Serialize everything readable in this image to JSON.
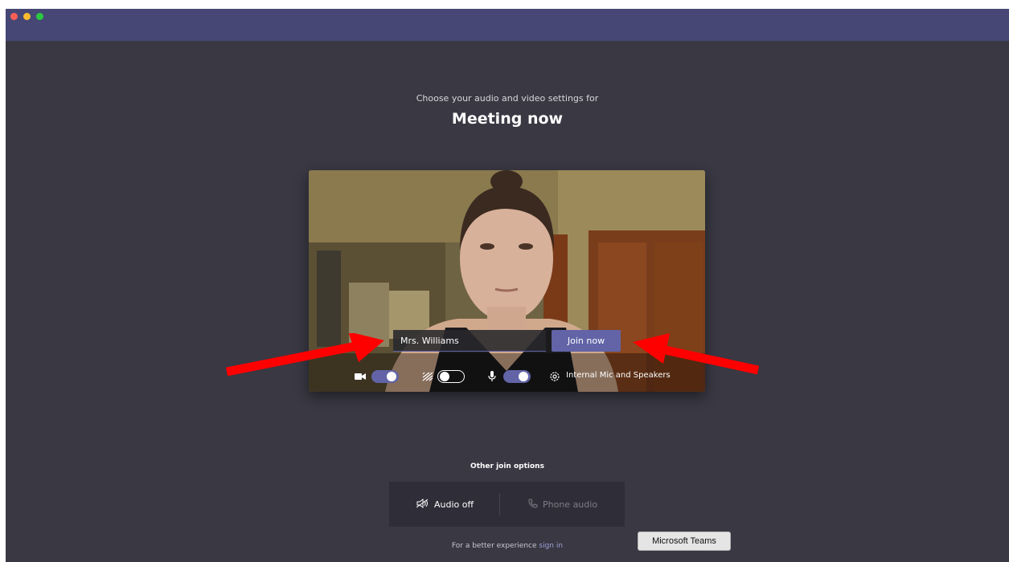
{
  "window": {
    "traffic_lights": [
      "close",
      "minimize",
      "zoom"
    ]
  },
  "prejoin": {
    "subtitle": "Choose your audio and video settings for",
    "meeting_title": "Meeting now"
  },
  "preview": {
    "name_value": "Mrs. Williams",
    "join_label": "Join now",
    "camera_toggle_on": true,
    "blur_toggle_on": false,
    "mic_toggle_on": true,
    "device_label": "Internal Mic and Speakers",
    "icons": [
      "camera-icon",
      "background-blur-icon",
      "microphone-icon",
      "device-settings-icon"
    ]
  },
  "other_join": {
    "heading": "Other join options",
    "audio_off_label": "Audio off",
    "phone_audio_label": "Phone audio"
  },
  "footer": {
    "text": "For a better experience",
    "link": "sign in"
  },
  "tooltip": {
    "text": "Microsoft Teams"
  },
  "colors": {
    "accent": "#6264a7",
    "titlebar": "#464775",
    "background": "#393843",
    "annotation_arrow": "#ff0000"
  }
}
